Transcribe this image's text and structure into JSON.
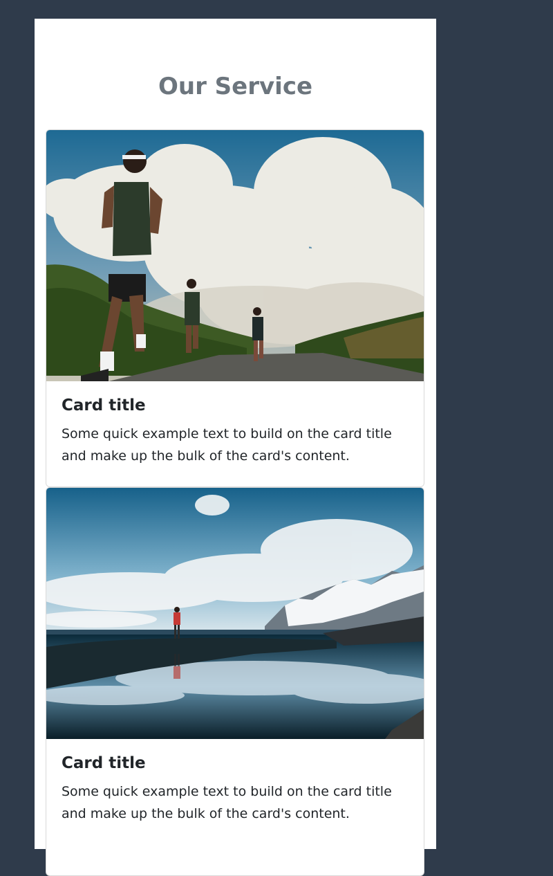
{
  "section": {
    "heading": "Our Service"
  },
  "cards": [
    {
      "image_alt": "Runners jogging on a road under a cloudy sky",
      "title": "Card title",
      "text": "Some quick example text to build on the card title and make up the bulk of the card's content."
    },
    {
      "image_alt": "Hiker standing on rocks beside a reflective lake with snowy mountains",
      "title": "Card title",
      "text": "Some quick example text to build on the card title and make up the bulk of the card's content."
    }
  ],
  "colors": {
    "page_background": "#2f3b4b",
    "heading_text": "#6c757d",
    "card_text": "#212529"
  }
}
